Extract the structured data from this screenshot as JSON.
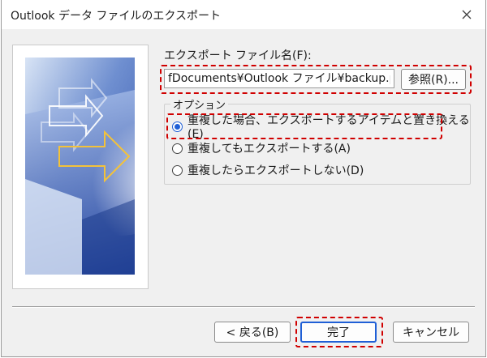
{
  "window": {
    "title": "Outlook データ ファイルのエクスポート"
  },
  "file": {
    "label": "エクスポート ファイル名(F):",
    "path_value": "fDocuments¥Outlook ファイル¥backup.pst",
    "browse_label": "参照(R)..."
  },
  "options": {
    "legend": "オプション",
    "items": [
      {
        "label": "重複した場合、エクスポートするアイテムと置き換える(E)",
        "selected": true
      },
      {
        "label": "重複してもエクスポートする(A)",
        "selected": false
      },
      {
        "label": "重複したらエクスポートしない(D)",
        "selected": false
      }
    ]
  },
  "buttons": {
    "back": "< 戻る(B)",
    "finish": "完了",
    "cancel": "キャンセル"
  },
  "icons": {
    "close": "close-icon",
    "illustration": "export-wizard-illustration"
  },
  "colors": {
    "highlight": "#d00000",
    "accent": "#1f5fd6"
  }
}
